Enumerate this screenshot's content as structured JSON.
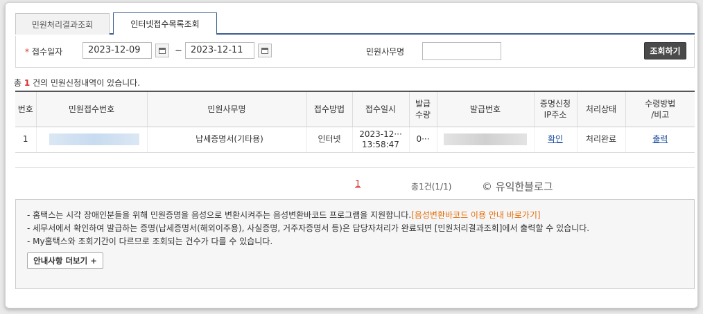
{
  "tabs": [
    {
      "label": "민원처리결과조회"
    },
    {
      "label": "인터넷접수목록조회"
    }
  ],
  "search": {
    "required_mark": "*",
    "date_label": "접수일자",
    "date_from": "2023-12-09",
    "date_to": "2023-12-11",
    "range_sep": "~",
    "name_label": "민원사무명",
    "name_value": "",
    "query_button": "조회하기"
  },
  "summary": {
    "prefix": "총",
    "count": "1",
    "suffix": "건의 민원신청내역이 있습니다."
  },
  "table": {
    "headers": {
      "no": "번호",
      "receipt_no": "민원접수번호",
      "service": "민원사무명",
      "method": "접수방법",
      "datetime": "접수일시",
      "qty_l1": "발급",
      "qty_l2": "수량",
      "issue_no": "발급번호",
      "ip_l1": "증명신청",
      "ip_l2": "IP주소",
      "status": "처리상태",
      "recv_l1": "수령방법",
      "recv_l2": "/비고"
    },
    "rows": [
      {
        "no": "1",
        "service": "납세증명서(기타용)",
        "method": "인터넷",
        "date": "2023-12···",
        "time": "13:58:47",
        "qty": "0···",
        "ip_link": "확인",
        "status": "처리완료",
        "receive_link": "출력"
      }
    ]
  },
  "pagination": {
    "current_page": "1",
    "info": "총1건(1/1)"
  },
  "watermark": "© 유익한블로그",
  "notice": {
    "line1": "- 홈택스는 시각 장애인분들을 위해 민원증명을 음성으로 변환시켜주는 음성변환바코드 프로그램을 지원합니다.",
    "line1_link": "[음성변환바코드 이용 안내 바로가기]",
    "line2": "- 세무서에서 확인하여 발급하는 증명(납세증명서(해외이주용), 사실증명, 거주자증명서 등)은 담당자처리가 완료되면 [민원처리결과조회]에서 출력할 수 있습니다.",
    "line3": "- My홈택스와 조회기간이 다르므로 조회되는 건수가 다를 수 있습니다.",
    "more_button": "안내사항 더보기 +"
  }
}
